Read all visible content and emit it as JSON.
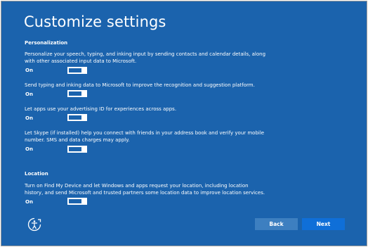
{
  "page": {
    "title": "Customize settings"
  },
  "personalization": {
    "heading": "Personalization",
    "settings": [
      {
        "description": "Personalize your speech, typing, and inking input by sending contacts and calendar details, along with other associated input data to Microsoft.",
        "state": "On"
      },
      {
        "description": "Send typing and inking data to Microsoft to improve the recognition and suggestion platform.",
        "state": "On"
      },
      {
        "description": "Let apps use your advertising ID for experiences across apps.",
        "state": "On"
      },
      {
        "description": "Let Skype (if installed) help you connect with friends in your address book and verify your mobile number. SMS and data charges may apply.",
        "state": "On"
      }
    ]
  },
  "location": {
    "heading": "Location",
    "settings": [
      {
        "description": "Turn on Find My Device and let Windows and apps request your location, including location history, and send Microsoft and trusted partners some location data to improve location services.",
        "state": "On"
      }
    ]
  },
  "footer": {
    "accessibility_icon": "ease-of-access-icon",
    "back_label": "Back",
    "next_label": "Next"
  },
  "colors": {
    "background": "#1b63ad",
    "toggle_on": "#ffffff",
    "back_button": "#3d7fc0",
    "next_button": "#0f6fd8"
  }
}
